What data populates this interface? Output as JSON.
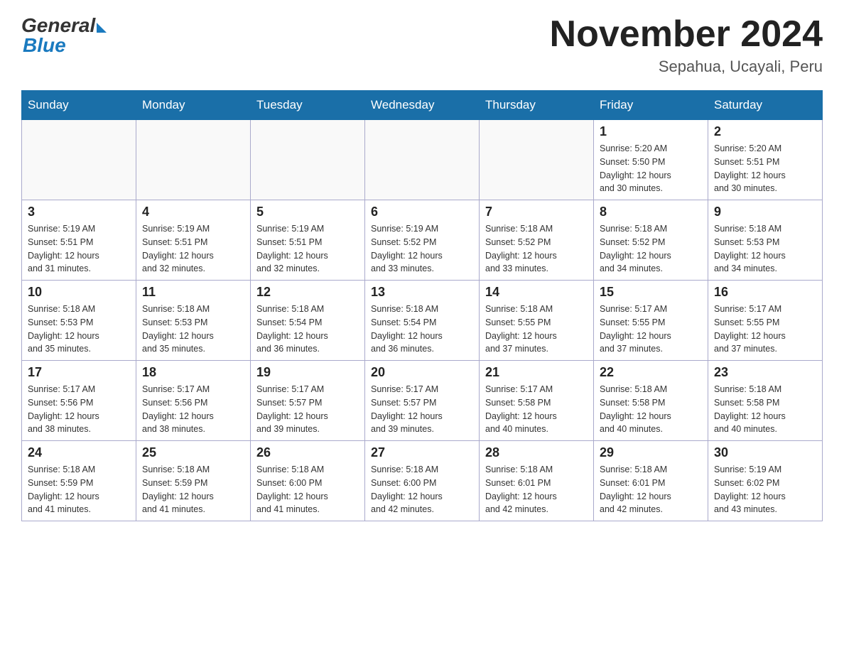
{
  "header": {
    "logo_general": "General",
    "logo_blue": "Blue",
    "month_title": "November 2024",
    "subtitle": "Sepahua, Ucayali, Peru"
  },
  "days_of_week": [
    "Sunday",
    "Monday",
    "Tuesday",
    "Wednesday",
    "Thursday",
    "Friday",
    "Saturday"
  ],
  "weeks": [
    [
      {
        "day": "",
        "info": ""
      },
      {
        "day": "",
        "info": ""
      },
      {
        "day": "",
        "info": ""
      },
      {
        "day": "",
        "info": ""
      },
      {
        "day": "",
        "info": ""
      },
      {
        "day": "1",
        "info": "Sunrise: 5:20 AM\nSunset: 5:50 PM\nDaylight: 12 hours\nand 30 minutes."
      },
      {
        "day": "2",
        "info": "Sunrise: 5:20 AM\nSunset: 5:51 PM\nDaylight: 12 hours\nand 30 minutes."
      }
    ],
    [
      {
        "day": "3",
        "info": "Sunrise: 5:19 AM\nSunset: 5:51 PM\nDaylight: 12 hours\nand 31 minutes."
      },
      {
        "day": "4",
        "info": "Sunrise: 5:19 AM\nSunset: 5:51 PM\nDaylight: 12 hours\nand 32 minutes."
      },
      {
        "day": "5",
        "info": "Sunrise: 5:19 AM\nSunset: 5:51 PM\nDaylight: 12 hours\nand 32 minutes."
      },
      {
        "day": "6",
        "info": "Sunrise: 5:19 AM\nSunset: 5:52 PM\nDaylight: 12 hours\nand 33 minutes."
      },
      {
        "day": "7",
        "info": "Sunrise: 5:18 AM\nSunset: 5:52 PM\nDaylight: 12 hours\nand 33 minutes."
      },
      {
        "day": "8",
        "info": "Sunrise: 5:18 AM\nSunset: 5:52 PM\nDaylight: 12 hours\nand 34 minutes."
      },
      {
        "day": "9",
        "info": "Sunrise: 5:18 AM\nSunset: 5:53 PM\nDaylight: 12 hours\nand 34 minutes."
      }
    ],
    [
      {
        "day": "10",
        "info": "Sunrise: 5:18 AM\nSunset: 5:53 PM\nDaylight: 12 hours\nand 35 minutes."
      },
      {
        "day": "11",
        "info": "Sunrise: 5:18 AM\nSunset: 5:53 PM\nDaylight: 12 hours\nand 35 minutes."
      },
      {
        "day": "12",
        "info": "Sunrise: 5:18 AM\nSunset: 5:54 PM\nDaylight: 12 hours\nand 36 minutes."
      },
      {
        "day": "13",
        "info": "Sunrise: 5:18 AM\nSunset: 5:54 PM\nDaylight: 12 hours\nand 36 minutes."
      },
      {
        "day": "14",
        "info": "Sunrise: 5:18 AM\nSunset: 5:55 PM\nDaylight: 12 hours\nand 37 minutes."
      },
      {
        "day": "15",
        "info": "Sunrise: 5:17 AM\nSunset: 5:55 PM\nDaylight: 12 hours\nand 37 minutes."
      },
      {
        "day": "16",
        "info": "Sunrise: 5:17 AM\nSunset: 5:55 PM\nDaylight: 12 hours\nand 37 minutes."
      }
    ],
    [
      {
        "day": "17",
        "info": "Sunrise: 5:17 AM\nSunset: 5:56 PM\nDaylight: 12 hours\nand 38 minutes."
      },
      {
        "day": "18",
        "info": "Sunrise: 5:17 AM\nSunset: 5:56 PM\nDaylight: 12 hours\nand 38 minutes."
      },
      {
        "day": "19",
        "info": "Sunrise: 5:17 AM\nSunset: 5:57 PM\nDaylight: 12 hours\nand 39 minutes."
      },
      {
        "day": "20",
        "info": "Sunrise: 5:17 AM\nSunset: 5:57 PM\nDaylight: 12 hours\nand 39 minutes."
      },
      {
        "day": "21",
        "info": "Sunrise: 5:17 AM\nSunset: 5:58 PM\nDaylight: 12 hours\nand 40 minutes."
      },
      {
        "day": "22",
        "info": "Sunrise: 5:18 AM\nSunset: 5:58 PM\nDaylight: 12 hours\nand 40 minutes."
      },
      {
        "day": "23",
        "info": "Sunrise: 5:18 AM\nSunset: 5:58 PM\nDaylight: 12 hours\nand 40 minutes."
      }
    ],
    [
      {
        "day": "24",
        "info": "Sunrise: 5:18 AM\nSunset: 5:59 PM\nDaylight: 12 hours\nand 41 minutes."
      },
      {
        "day": "25",
        "info": "Sunrise: 5:18 AM\nSunset: 5:59 PM\nDaylight: 12 hours\nand 41 minutes."
      },
      {
        "day": "26",
        "info": "Sunrise: 5:18 AM\nSunset: 6:00 PM\nDaylight: 12 hours\nand 41 minutes."
      },
      {
        "day": "27",
        "info": "Sunrise: 5:18 AM\nSunset: 6:00 PM\nDaylight: 12 hours\nand 42 minutes."
      },
      {
        "day": "28",
        "info": "Sunrise: 5:18 AM\nSunset: 6:01 PM\nDaylight: 12 hours\nand 42 minutes."
      },
      {
        "day": "29",
        "info": "Sunrise: 5:18 AM\nSunset: 6:01 PM\nDaylight: 12 hours\nand 42 minutes."
      },
      {
        "day": "30",
        "info": "Sunrise: 5:19 AM\nSunset: 6:02 PM\nDaylight: 12 hours\nand 43 minutes."
      }
    ]
  ]
}
